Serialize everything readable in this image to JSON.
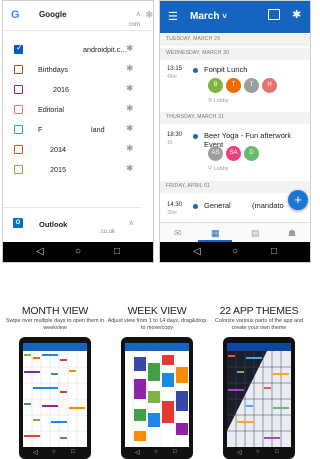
{
  "left_phone": {
    "account_google": {
      "logo": "G",
      "name": "Google",
      "sub": ".com"
    },
    "calendars": [
      {
        "name": "androidpit.c…",
        "checked": true,
        "color": "#0b57d0"
      },
      {
        "name": "Birthdays",
        "checked": false,
        "color": "#a0522d"
      },
      {
        "name": "2016",
        "checked": false,
        "color": "#8e24aa"
      },
      {
        "name": "Editorial",
        "checked": false,
        "color": "#e67c73"
      },
      {
        "name": "F",
        "name_right": "land",
        "checked": false,
        "color": "#33b679"
      },
      {
        "name": "2014",
        "checked": false,
        "color": "#f4511e"
      },
      {
        "name": "2015",
        "checked": false,
        "color": "#7cb342"
      }
    ],
    "account_outlook": {
      "logo": "O",
      "name": "Outlook",
      "sub": ".co.uk"
    }
  },
  "right_phone": {
    "month": "March",
    "days": [
      {
        "header": "TUESDAY, MARCH 29"
      },
      {
        "header": "WEDNESDAY, MARCH 30"
      },
      {
        "header": "THURSDAY, MARCH 31"
      },
      {
        "header": "FRIDAY, APRIL 01"
      }
    ],
    "events": [
      {
        "time": "13:15",
        "dur": "45m",
        "title": "Fonpit Lunch",
        "location": "Lobby",
        "attendees": [
          {
            "initial": "B",
            "color": "#7cb342"
          },
          {
            "initial": "T",
            "color": "#ef6c00"
          },
          {
            "initial": "T",
            "color": "#9e9e9e"
          },
          {
            "initial": "H",
            "color": "#e57373"
          }
        ]
      },
      {
        "time": "18:30",
        "dur": "1h",
        "title": "Beer Yoga - Fun afterwork Event",
        "location": "Lobby",
        "attendees": [
          {
            "initial": "AS",
            "color": "#9e9e9e"
          },
          {
            "initial": "SA",
            "color": "#ec407a"
          },
          {
            "initial": "D",
            "color": "#66bb6a"
          }
        ]
      },
      {
        "time": "14:30",
        "dur": "30m",
        "title": "General",
        "title_right": "(mandato"
      }
    ],
    "fab": "+"
  },
  "features": [
    {
      "title": "MONTH VIEW",
      "desc": "Swipe over multiple days to open them in weekview"
    },
    {
      "title": "WEEK VIEW",
      "desc": "Adjust view from 1 to 14 days, drag&drop to move/copy"
    },
    {
      "title": "22 APP THEMES",
      "desc": "Colorize various parts of the app and create your own theme"
    }
  ],
  "icons": {
    "gear": "gear-icon",
    "menu": "menu-icon",
    "chevron": "chevron-down-icon",
    "back": "back-icon",
    "home": "home-icon",
    "recents": "recents-icon"
  },
  "colors": {
    "brand_blue": "#1565c0",
    "google_blue": "#4285f4",
    "outlook_blue": "#0072c6"
  }
}
